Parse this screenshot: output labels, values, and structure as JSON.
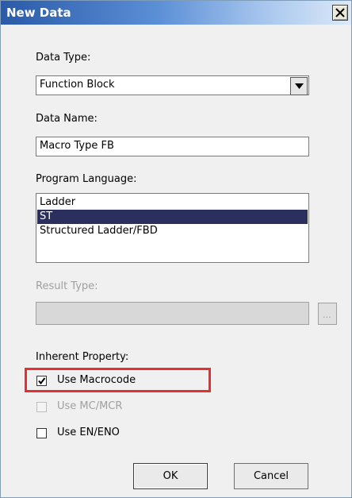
{
  "dialog": {
    "title": "New Data",
    "close_label": "close"
  },
  "data_type": {
    "label": "Data Type:",
    "value": "Function Block"
  },
  "data_name": {
    "label": "Data Name:",
    "value": "Macro Type FB"
  },
  "program_language": {
    "label": "Program Language:",
    "items": [
      "Ladder",
      "ST",
      "Structured Ladder/FBD"
    ],
    "selected": "ST"
  },
  "result_type": {
    "label": "Result Type:",
    "value": "",
    "browse_label": "..."
  },
  "inherent_property": {
    "label": "Inherent Property:",
    "options": [
      {
        "label": "Use Macrocode",
        "checked": true,
        "enabled": true
      },
      {
        "label": "Use MC/MCR",
        "checked": false,
        "enabled": false
      },
      {
        "label": "Use EN/ENO",
        "checked": false,
        "enabled": true
      }
    ]
  },
  "buttons": {
    "ok": "OK",
    "cancel": "Cancel"
  },
  "colors": {
    "highlight": "#e53030",
    "selection": "#2b2f5e"
  }
}
